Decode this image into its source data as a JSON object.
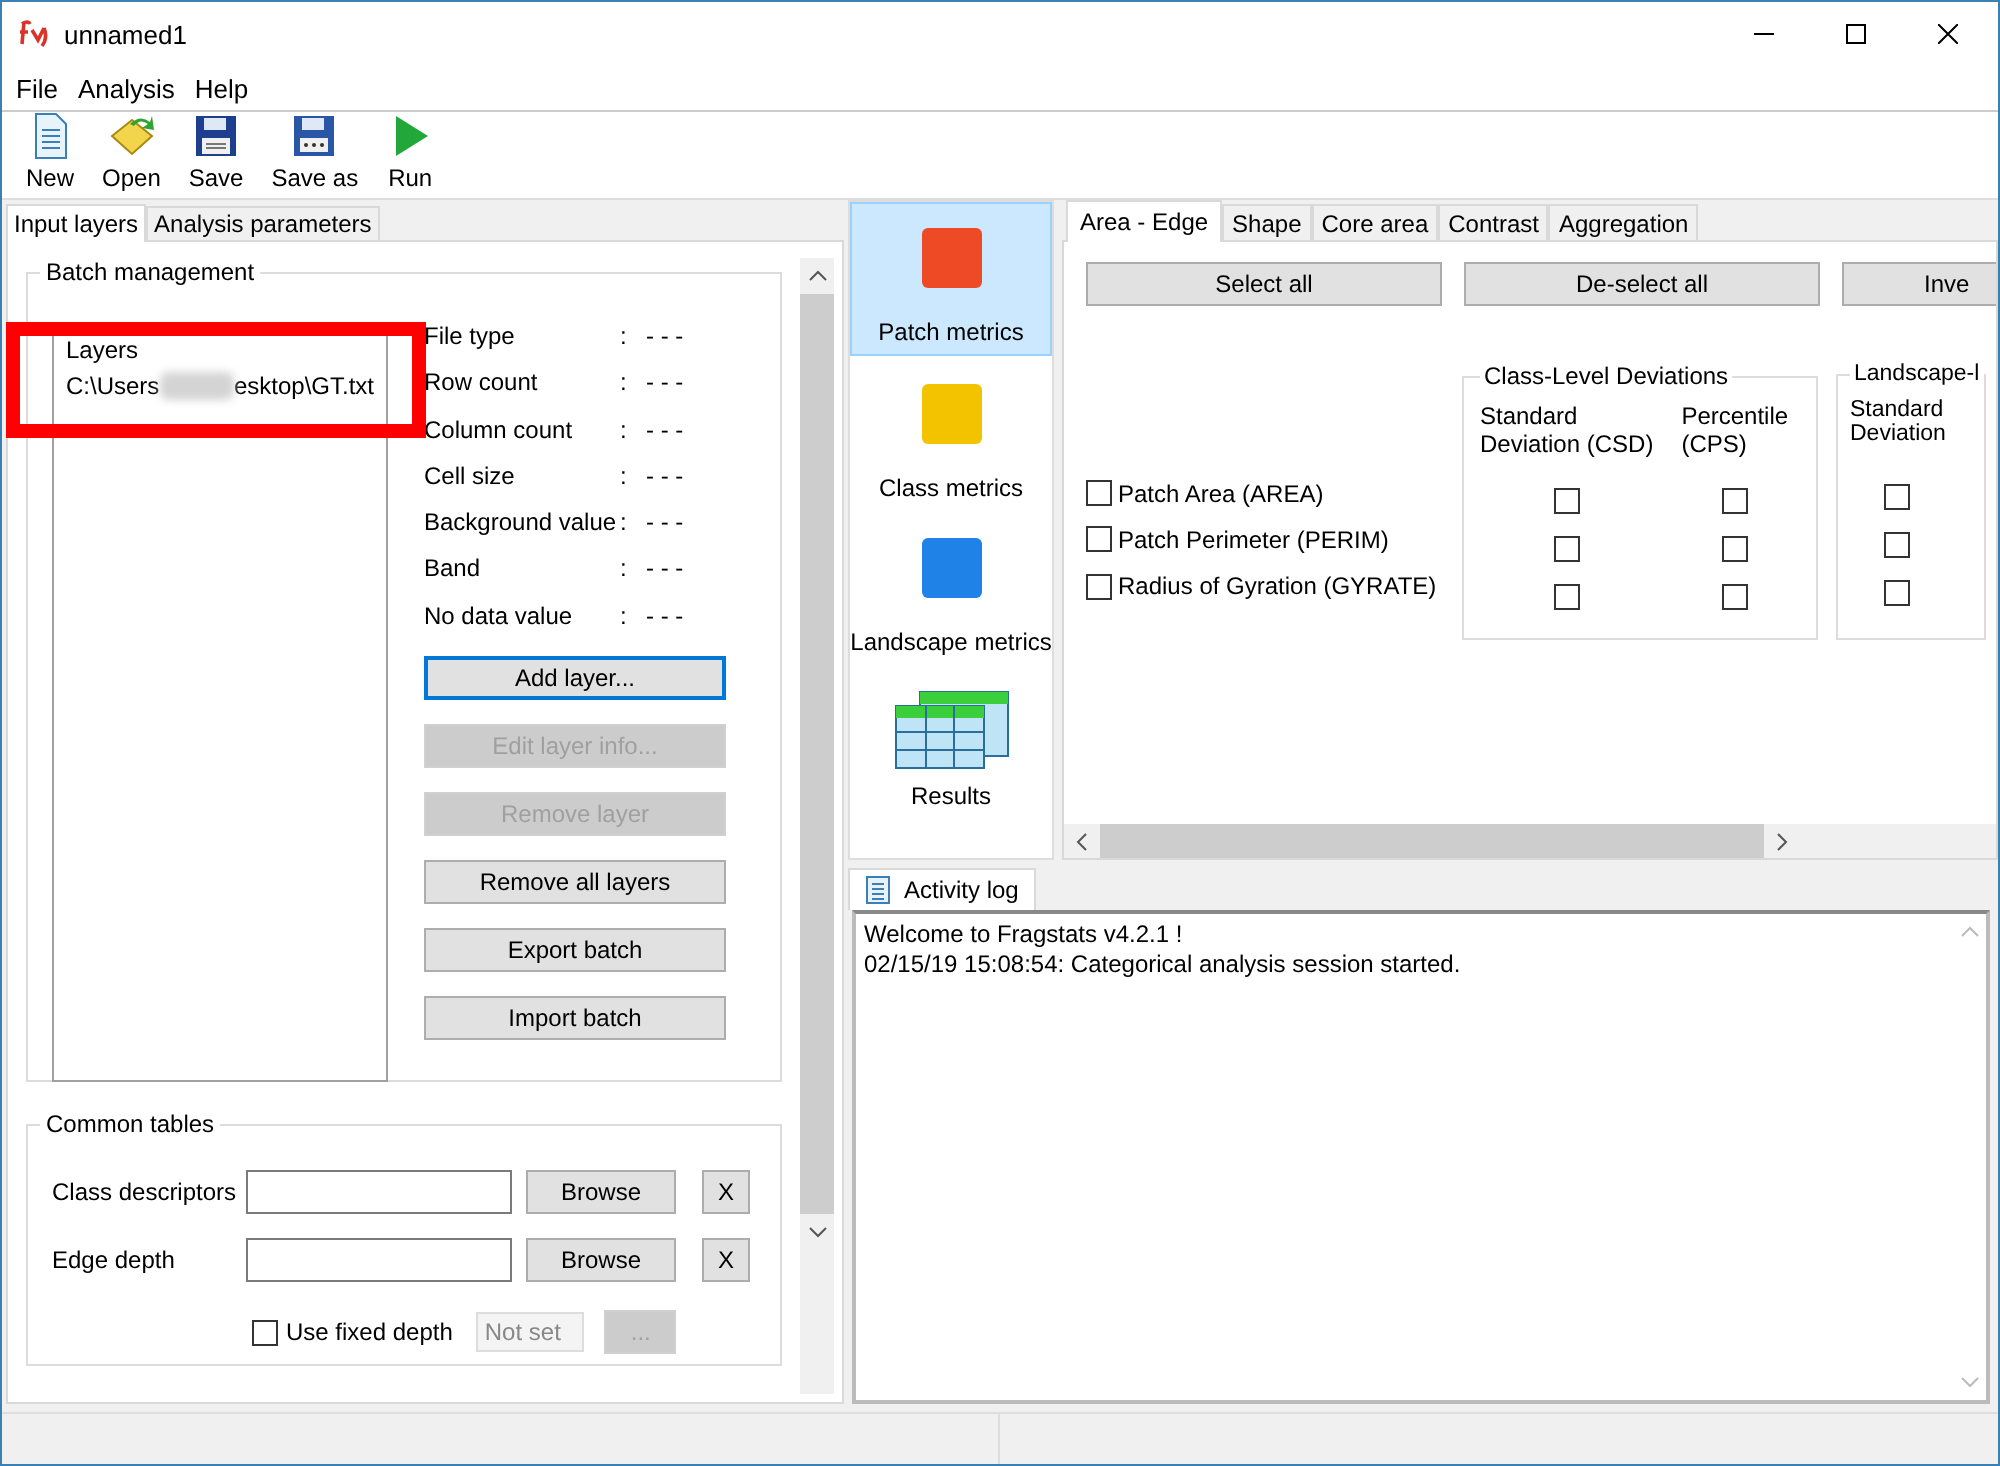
{
  "window": {
    "title": "unnamed1"
  },
  "menu": [
    "File",
    "Analysis",
    "Help"
  ],
  "toolbar": [
    {
      "label": "New",
      "kind": "new"
    },
    {
      "label": "Open",
      "kind": "open"
    },
    {
      "label": "Save",
      "kind": "save"
    },
    {
      "label": "Save as",
      "kind": "saveas"
    },
    {
      "label": "Run",
      "kind": "run"
    }
  ],
  "left_tabs": [
    {
      "label": "Input layers",
      "selected": true
    },
    {
      "label": "Analysis parameters",
      "selected": false
    }
  ],
  "batch": {
    "title": "Batch management",
    "layers_heading": "Layers",
    "layer_path_start": "C:\\Users",
    "layer_path_end": "esktop\\GT.txt",
    "info": [
      {
        "label": "File type",
        "sep": ":",
        "value": "- - -"
      },
      {
        "label": "Row count",
        "sep": ":",
        "value": "- - -"
      },
      {
        "label": "Column count",
        "sep": ":",
        "value": "- - -"
      },
      {
        "label": "Cell size",
        "sep": ":",
        "value": "- - -"
      },
      {
        "label": "Background value",
        "sep": ":",
        "value": "- - -"
      },
      {
        "label": "Band",
        "sep": ":",
        "value": "- - -"
      },
      {
        "label": "No data value",
        "sep": ":",
        "value": "- - -"
      }
    ],
    "buttons": [
      {
        "label": "Add layer...",
        "disabled": false,
        "focused": true
      },
      {
        "label": "Edit layer info...",
        "disabled": true,
        "focused": false
      },
      {
        "label": "Remove layer",
        "disabled": true,
        "focused": false
      },
      {
        "label": "Remove all layers",
        "disabled": false,
        "focused": false
      },
      {
        "label": "Export batch",
        "disabled": false,
        "focused": false
      },
      {
        "label": "Import batch",
        "disabled": false,
        "focused": false
      }
    ]
  },
  "common_tables": {
    "title": "Common tables",
    "rows": [
      {
        "label": "Class descriptors",
        "browse": "Browse",
        "clear": "X"
      },
      {
        "label": "Edge depth",
        "browse": "Browse",
        "clear": "X"
      }
    ],
    "fixed_depth": {
      "label": "Use fixed depth",
      "checked": false,
      "value": "Not set",
      "more": "..."
    }
  },
  "metric_levels": [
    {
      "label": "Patch metrics",
      "kind": "square",
      "color": "#ee4a25",
      "selected": true
    },
    {
      "label": "Class metrics",
      "kind": "square",
      "color": "#f4c300",
      "selected": false
    },
    {
      "label": "Landscape metrics",
      "kind": "square",
      "color": "#1e82e6",
      "selected": false
    },
    {
      "label": "Results",
      "kind": "table",
      "selected": false
    }
  ],
  "metric_tabs": [
    {
      "label": "Area - Edge",
      "selected": true
    },
    {
      "label": "Shape",
      "selected": false
    },
    {
      "label": "Core area",
      "selected": false
    },
    {
      "label": "Contrast",
      "selected": false
    },
    {
      "label": "Aggregation",
      "selected": false
    }
  ],
  "actions": [
    "Select all",
    "De-select all",
    "Inve"
  ],
  "groups": [
    {
      "title": "Class-Level Deviations",
      "columns": [
        "Standard\nDeviation  (CSD)",
        "Percentile\n(CPS)"
      ]
    },
    {
      "title": "Landscape-l",
      "columns": [
        "Standard\nDeviation"
      ]
    }
  ],
  "metrics": [
    {
      "label": "Patch Area  (AREA)",
      "checked": false,
      "group_checks": [
        [
          false,
          false
        ],
        [
          false
        ]
      ]
    },
    {
      "label": "Patch Perimeter  (PERIM)",
      "checked": false,
      "group_checks": [
        [
          false,
          false
        ],
        [
          false
        ]
      ]
    },
    {
      "label": "Radius of Gyration  (GYRATE)",
      "checked": false,
      "group_checks": [
        [
          false,
          false
        ],
        [
          false
        ]
      ]
    }
  ],
  "activity_log": {
    "title": "Activity log",
    "lines": [
      "Welcome to Fragstats v4.2.1 !",
      "02/15/19 15:08:54: Categorical analysis session started."
    ]
  },
  "annotation": {
    "kind": "rectangle"
  }
}
